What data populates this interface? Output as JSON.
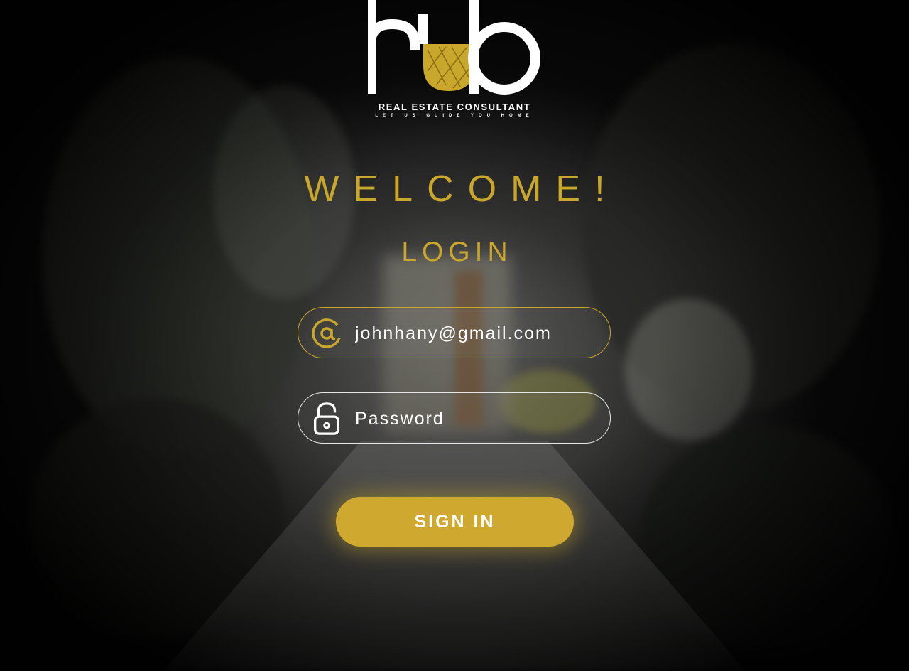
{
  "brand": {
    "logo_text": "hub",
    "tagline": "REAL ESTATE CONSULTANT",
    "subtagline": "LET US GUIDE YOU HOME"
  },
  "headings": {
    "welcome": "WELCOME!",
    "login": "LOGIN"
  },
  "form": {
    "email": {
      "value": "johnhany@gmail.com",
      "icon": "at-sign-icon"
    },
    "password": {
      "placeholder": "Password",
      "icon": "padlock-icon"
    },
    "submit_label": "SIGN IN"
  },
  "colors": {
    "accent": "#cfa82f",
    "text": "#ffffff"
  }
}
